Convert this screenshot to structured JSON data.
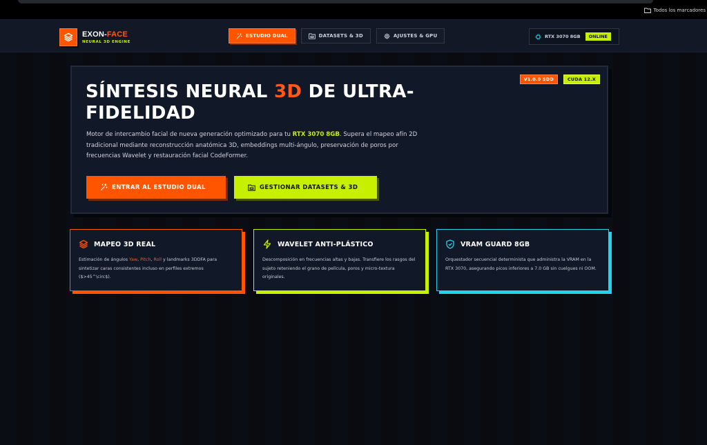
{
  "browser": {
    "bookmarks_label": "Todos los marcadores"
  },
  "brand": {
    "name_part1": "EXON-",
    "name_part2": "FACE",
    "subtitle": "NEURAL 3D ENGINE",
    "logo_icon": "layers-icon"
  },
  "nav": {
    "tabs": [
      {
        "label": "ESTUDIO DUAL",
        "icon": "sparkles-icon",
        "active": true
      },
      {
        "label": "DATASETS & 3D",
        "icon": "folder-icon",
        "active": false
      },
      {
        "label": "AJUSTES & GPU",
        "icon": "gear-icon",
        "active": false
      }
    ]
  },
  "status": {
    "gpu_label": "RTX 3070 8GB",
    "online_label": "ONLINE",
    "chip_icon": "cpu-icon"
  },
  "hero": {
    "version_badge": "V1.0.0 SDD",
    "cuda_badge": "CUDA 12.X",
    "title_part1": "SÍNTESIS NEURAL ",
    "title_accent": "3D",
    "title_part2": " DE ULTRA-FIDELIDAD",
    "desc_part1": "Motor de intercambio facial de nueva generación optimizado para tu ",
    "desc_highlight": "RTX 3070 8GB",
    "desc_part2": ". Supera el mapeo afín 2D tradicional mediante reconstrucción anatómica 3D, embeddings multi-ángulo, preservación de poros por frecuencias Wavelet y restauración facial CodeFormer.",
    "primary_button": "ENTRAR AL ESTUDIO DUAL",
    "secondary_button": "GESTIONAR DATASETS & 3D"
  },
  "features": [
    {
      "title": "MAPEO 3D REAL",
      "icon": "layers-icon",
      "body_part1": "Estimación de ángulos ",
      "body_yaw": "Yaw",
      "body_sep1": ", ",
      "body_pitch": "Pitch",
      "body_sep2": ", ",
      "body_roll": "Roll",
      "body_part2": " y landmarks 3DDFA para sintetizar caras consistentes incluso en perfiles extremos ($>45^\\circ$)."
    },
    {
      "title": "WAVELET ANTI-PLÁSTICO",
      "icon": "lightning-icon",
      "body": "Descomposición en frecuencias altas y bajas. Transfiere los rasgos del sujeto reteniendo el grano de película, poros y micro-textura originales."
    },
    {
      "title": "VRAM GUARD 8GB",
      "icon": "shield-icon",
      "body": "Orquestador secuencial determinista que administra la VRAM en la RTX 3070, asegurando picos inferiores a 7.0 GB sin cuelgues ni OOM."
    }
  ],
  "colors": {
    "orange": "#ff5500",
    "lime": "#c7f000",
    "cyan": "#22d3ee",
    "panel": "#111827",
    "background": "#080a10"
  }
}
